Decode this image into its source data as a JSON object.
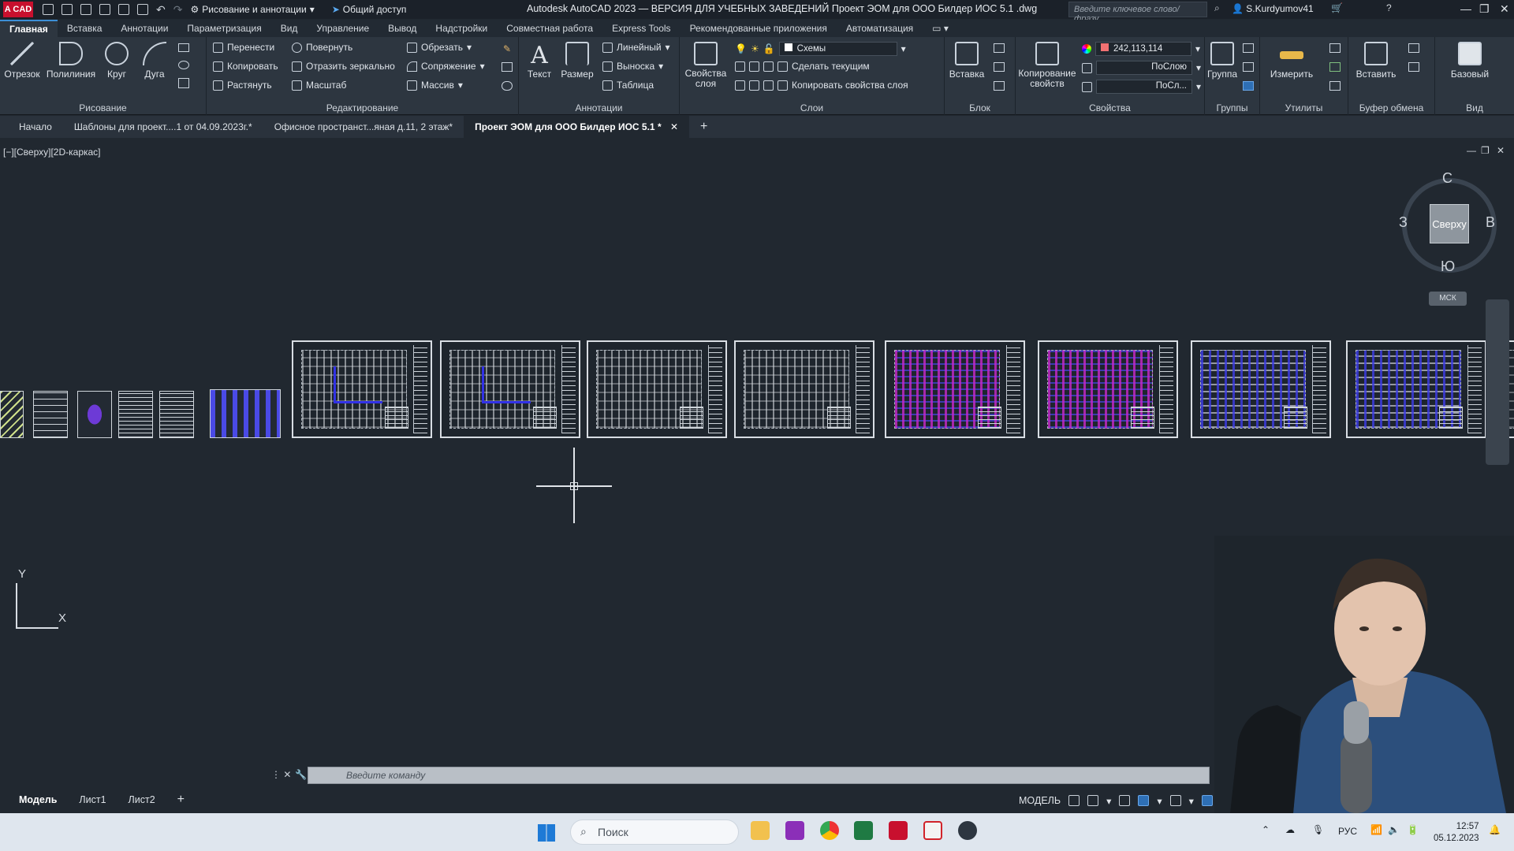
{
  "titlebar": {
    "logo": "A CAD",
    "workspace": "Рисование и аннотации",
    "share": "Общий доступ",
    "title": "Autodesk AutoCAD 2023 — ВЕРСИЯ ДЛЯ УЧЕБНЫХ ЗАВЕДЕНИЙ    Проект ЭОМ для ООО Билдер ИОС 5.1 .dwg",
    "search_placeholder": "Введите ключевое слово/фразу",
    "user": "S.Kurdyumov41"
  },
  "menu_tabs": [
    "Главная",
    "Вставка",
    "Аннотации",
    "Параметризация",
    "Вид",
    "Управление",
    "Вывод",
    "Надстройки",
    "Совместная работа",
    "Express Tools",
    "Рекомендованные приложения",
    "Автоматизация"
  ],
  "ribbon": {
    "draw": {
      "label": "Рисование",
      "line": "Отрезок",
      "polyline": "Полилиния",
      "circle": "Круг",
      "arc": "Дуга"
    },
    "modify": {
      "label": "Редактирование",
      "move": "Перенести",
      "rotate": "Повернуть",
      "trim": "Обрезать",
      "copy": "Копировать",
      "mirror": "Отразить зеркально",
      "fillet": "Сопряжение",
      "stretch": "Растянуть",
      "scale": "Масштаб",
      "array": "Массив"
    },
    "annotation": {
      "label": "Аннотации",
      "text": "Текст",
      "dimension": "Размер",
      "linear": "Линейный",
      "leader": "Выноска",
      "table": "Таблица"
    },
    "layers": {
      "label": "Слои",
      "props": "Свойства слоя",
      "current_layer": "Схемы",
      "make_current": "Сделать текущим",
      "match_layer": "Копировать свойства слоя"
    },
    "block": {
      "label": "Блок",
      "insert": "Вставка"
    },
    "properties": {
      "label": "Свойства",
      "match": "Копирование свойств",
      "color": "242,113,114",
      "linetype": "ПоСлою",
      "lineweight": "ПоСл..."
    },
    "groups": {
      "label": "Группы",
      "group": "Группа"
    },
    "utilities": {
      "label": "Утилиты",
      "measure": "Измерить"
    },
    "clipboard": {
      "label": "Буфер обмена",
      "paste": "Вставить"
    },
    "view": {
      "label": "Вид",
      "base": "Базовый"
    }
  },
  "file_tabs": [
    "Начало",
    "Шаблоны для проект....1 от 04.09.2023г.*",
    "Офисное пространст...яная д.11, 2 этаж*",
    "Проект ЭОМ для ООО Билдер ИОС 5.1 *"
  ],
  "viewport": {
    "label": "[−][Сверху][2D-каркас]"
  },
  "viewcube": {
    "face": "Сверху",
    "north": "С",
    "south": "Ю",
    "west": "З",
    "east": "В",
    "ucs": "МСК"
  },
  "ucs": {
    "x": "X",
    "y": "Y"
  },
  "command": {
    "placeholder": "Введите команду"
  },
  "layout_tabs": [
    "Модель",
    "Лист1",
    "Лист2"
  ],
  "status": {
    "mode": "МОДЕЛЬ"
  },
  "taskbar": {
    "search": "Поиск",
    "lang": "РУС",
    "time": "12:57",
    "date": "05.12.2023"
  },
  "colors": {
    "accent": "#3c8fd6",
    "autocad_red": "#c8102e",
    "layer_color": "#f27172"
  }
}
